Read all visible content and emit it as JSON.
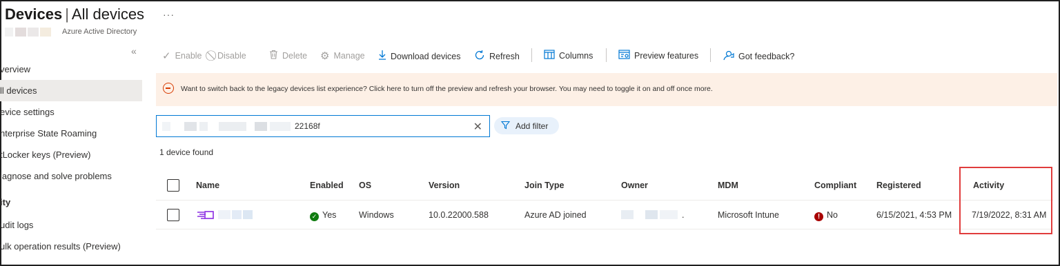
{
  "header": {
    "title_bold": "Devices",
    "title_separator": "|",
    "title_rest": "All devices",
    "subtitle": "Azure Active Directory",
    "more": "···",
    "collapse": "«"
  },
  "sidebar": {
    "items": [
      {
        "label": "verview"
      },
      {
        "label": "ll devices"
      },
      {
        "label": "evice settings"
      },
      {
        "label": "nterprise State Roaming"
      },
      {
        "label": "tLocker keys (Preview)"
      },
      {
        "label": "iagnose and solve problems"
      },
      {
        "label": "ity"
      },
      {
        "label": "udit logs"
      },
      {
        "label": "ulk operation results (Preview)"
      }
    ]
  },
  "toolbar": {
    "enable": "Enable",
    "disable": "Disable",
    "delete": "Delete",
    "manage": "Manage",
    "download": "Download devices",
    "refresh": "Refresh",
    "columns": "Columns",
    "preview": "Preview features",
    "feedback": "Got feedback?"
  },
  "banner": {
    "text": "Want to switch back to the legacy devices list experience? Click here to turn off the preview and refresh your browser. You may need to toggle it on and off once more."
  },
  "search": {
    "value": "22168f",
    "clear": "✕"
  },
  "filter": {
    "label": "Add filter"
  },
  "results": {
    "count": "1 device found"
  },
  "table": {
    "headers": {
      "name": "Name",
      "enabled": "Enabled",
      "os": "OS",
      "version": "Version",
      "join_type": "Join Type",
      "owner": "Owner",
      "mdm": "MDM",
      "compliant": "Compliant",
      "registered": "Registered",
      "activity": "Activity"
    },
    "rows": [
      {
        "enabled": "Yes",
        "os": "Windows",
        "version": "10.0.22000.588",
        "join_type": "Azure AD joined",
        "owner_suffix": ".",
        "mdm": "Microsoft Intune",
        "compliant": "No",
        "registered": "6/15/2021, 4:53 PM",
        "activity": "7/19/2022, 8:31 AM"
      }
    ]
  },
  "colors": {
    "accent": "#0078d4",
    "banner_bg": "#fdf0e6",
    "highlight": "#e03c3c",
    "ok": "#107c10",
    "error": "#a80000"
  }
}
